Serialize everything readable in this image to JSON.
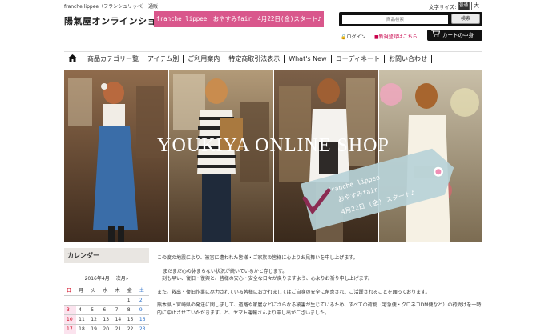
{
  "header": {
    "tagline": "franche lippee（フランシュリッペ） 通販",
    "font_size_label": "文字サイズ:",
    "font_size_normal": "普通",
    "font_size_large": "大",
    "logo": "陽氣屋オンラインショップ",
    "banner_text": "franche lippee　おやすみfair　4月22日(金)スタート♪",
    "banner_color": "#d9578c",
    "search_placeholder": "商品検索",
    "search_button": "検索",
    "login_label": "ログイン",
    "register_label": "新規登録はこちら",
    "cart_label": "カートの中身"
  },
  "nav": {
    "home_icon": "home-icon",
    "items": [
      "商品カテゴリー覧",
      "アイテム別",
      "ご利用案内",
      "特定商取引法表示",
      "What's New",
      "コーディネート",
      "お問い合わせ"
    ]
  },
  "hero": {
    "title": "YOUKIYA ONLINE SHOP",
    "tag_line1": "franche lippee",
    "tag_line2": "おやすみfair",
    "tag_line3": "4月22日 (金) スタート♪"
  },
  "sidebar": {
    "heading": "カレンダー",
    "month": "2016年4月",
    "next": "次月»",
    "weekdays": [
      "日",
      "月",
      "火",
      "水",
      "木",
      "金",
      "土"
    ],
    "weeks": [
      [
        "",
        "",
        "",
        "",
        "",
        "1",
        "2"
      ],
      [
        "3",
        "4",
        "5",
        "6",
        "7",
        "8",
        "9"
      ],
      [
        "10",
        "11",
        "12",
        "13",
        "14",
        "15",
        "16"
      ],
      [
        "17",
        "18",
        "19",
        "20",
        "21",
        "22",
        "23"
      ]
    ]
  },
  "main": {
    "paragraphs": [
      "この度の地震により、被害に遭われた皆様・ご家族の皆様に心よりお見舞いを申し上げます。",
      "まだまだ心の休まらない状況が続いているかと存じます。",
      "一刻も早い、復旧・復興と、皆様の安心・安全な日々が戻りますよう、心よりお祈り申し上げます。",
      "また、救出・復旧作業に尽力されている皆様におかれましてはご自身の安全に留意され、ご活躍されることを願っております。",
      "熊本県・宮崎県の発送に関しまして、道路や家屋などにさらなる被害が生じているため、すべての荷物（宅急便・クロネコDM便など）の荷受けを一時的に中止させていただきます。と、ヤマト運輸さんより申し出がございました。"
    ]
  }
}
